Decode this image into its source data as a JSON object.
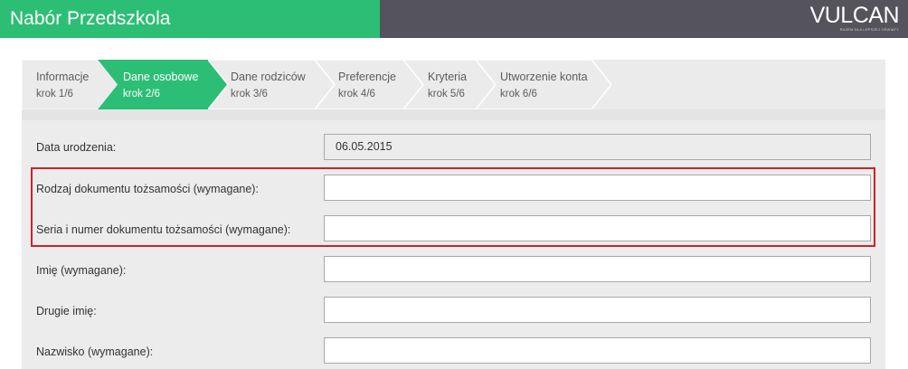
{
  "header": {
    "title": "Nabór Przedszkola",
    "logo_text": "VULCAN",
    "logo_tagline": "Razem dla lepszej oświaty",
    "colors": {
      "left": "#2dbe76",
      "right": "#55545c"
    }
  },
  "steps": [
    {
      "title": "Informacje",
      "sub": "krok 1/6",
      "active": false
    },
    {
      "title": "Dane osobowe",
      "sub": "krok 2/6",
      "active": true
    },
    {
      "title": "Dane rodziców",
      "sub": "krok 3/6",
      "active": false
    },
    {
      "title": "Preferencje",
      "sub": "krok 4/6",
      "active": false
    },
    {
      "title": "Kryteria",
      "sub": "krok 5/6",
      "active": false
    },
    {
      "title": "Utworzenie konta",
      "sub": "krok 6/6",
      "active": false
    }
  ],
  "form": {
    "fields": [
      {
        "label": "Data urodzenia:",
        "value": "06.05.2015",
        "readonly": true
      },
      {
        "label": "Rodzaj dokumentu tożsamości (wymagane):",
        "value": "",
        "readonly": false
      },
      {
        "label": "Seria i numer dokumentu tożsamości (wymagane):",
        "value": "",
        "readonly": false
      },
      {
        "label": "Imię (wymagane):",
        "value": "",
        "readonly": false
      },
      {
        "label": "Drugie imię:",
        "value": "",
        "readonly": false
      },
      {
        "label": "Nazwisko (wymagane):",
        "value": "",
        "readonly": false
      }
    ]
  },
  "highlight_color": "#d0202a"
}
